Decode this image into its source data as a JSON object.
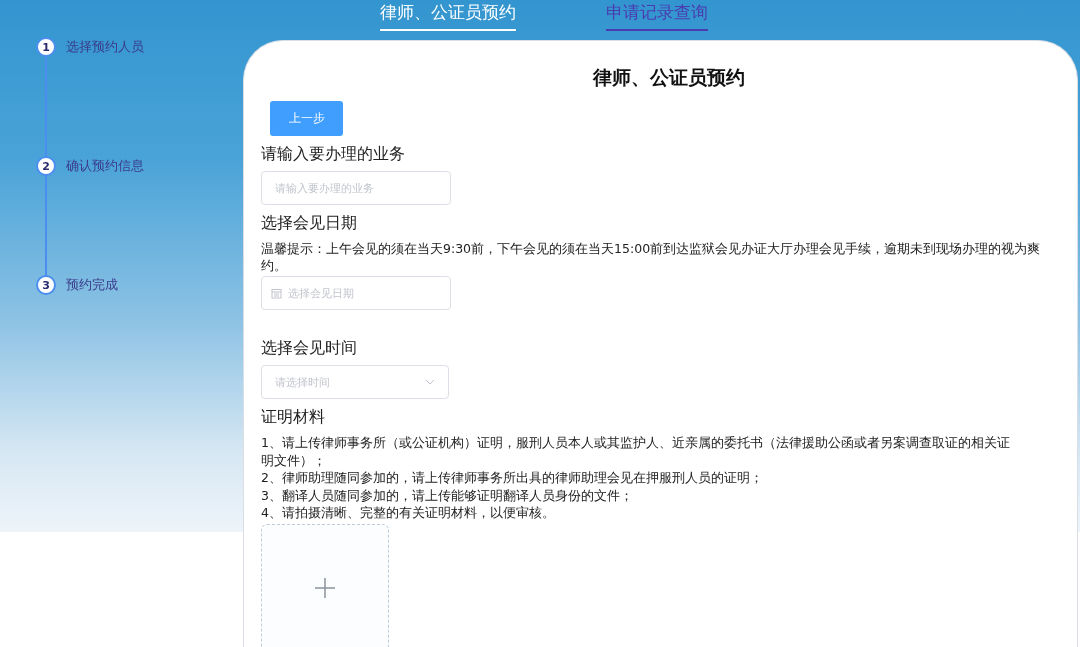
{
  "tabs": [
    {
      "label": "律师、公证员预约",
      "selected": true
    },
    {
      "label": "申请记录查询",
      "selected": false
    }
  ],
  "steps": [
    {
      "number": "1",
      "label": "选择预约人员"
    },
    {
      "number": "2",
      "label": "确认预约信息"
    },
    {
      "number": "3",
      "label": "预约完成"
    }
  ],
  "form": {
    "title": "律师、公证员预约",
    "back_button": "上一步",
    "business": {
      "label": "请输入要办理的业务",
      "placeholder": "请输入要办理的业务"
    },
    "date": {
      "label": "选择会见日期",
      "hint": "温馨提示：上午会见的须在当天9:30前，下午会见的须在当天15:00前到达监狱会见办证大厅办理会见手续，逾期未到现场办理的视为爽约。",
      "placeholder": "选择会见日期"
    },
    "time": {
      "label": "选择会见时间",
      "placeholder": "请选择时间"
    },
    "materials": {
      "label": "证明材料",
      "notes": [
        "1、请上传律师事务所（或公证机构）证明，服刑人员本人或其监护人、近亲属的委托书（法律援助公函或者另案调查取证的相关证明文件）；",
        "2、律师助理随同参加的，请上传律师事务所出具的律师助理会见在押服刑人员的证明；",
        "3、翻译人员随同参加的，请上传能够证明翻译人员身份的文件；",
        "4、请拍摄清晰、完整的有关证明材料，以便审核。"
      ]
    }
  }
}
